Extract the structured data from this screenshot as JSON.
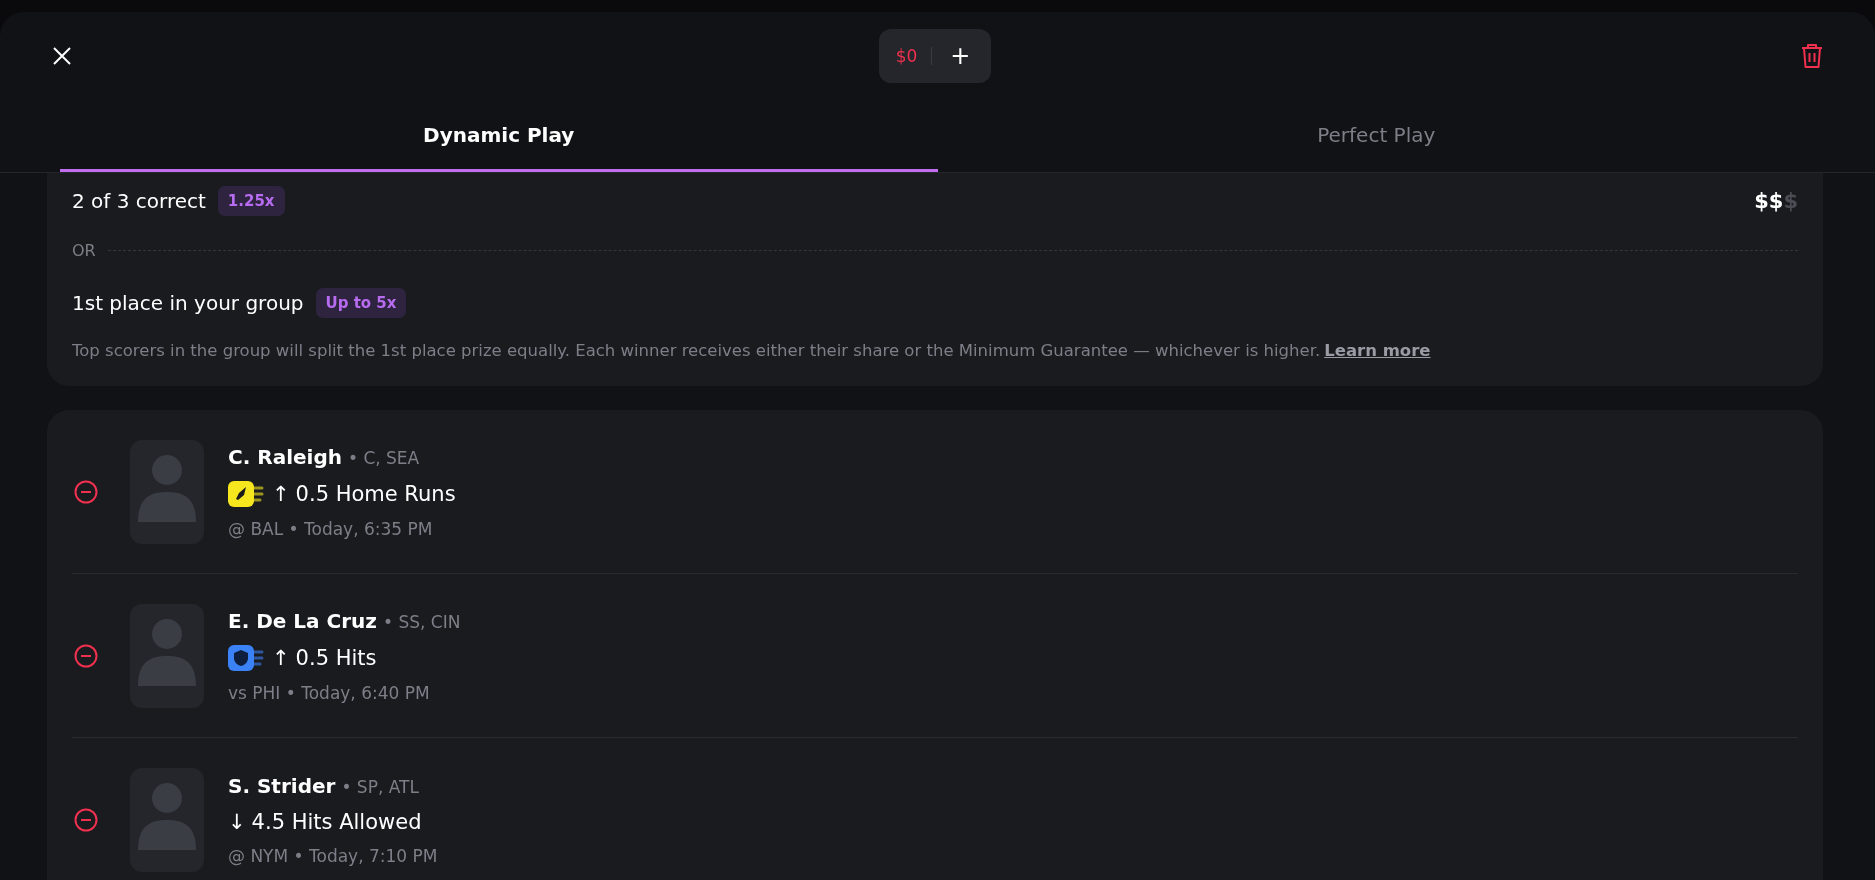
{
  "header": {
    "stake": "$0",
    "add": "+"
  },
  "tabs": [
    {
      "label": "Dynamic Play",
      "selected": true
    },
    {
      "label": "Perfect Play",
      "selected": false
    }
  ],
  "payout": {
    "correct": "2 of 3 correct",
    "multiplier": "1.25x",
    "cost": [
      {
        "symbol": "$",
        "on": true
      },
      {
        "symbol": "$",
        "on": true
      },
      {
        "symbol": "$",
        "on": false
      }
    ],
    "or": "OR",
    "group": "1st place in your group",
    "group_badge": "Up to 5x",
    "note": "Top scorers in the group will split the 1st place prize equally. Each winner receives either their share or the Minimum Guarantee — whichever is higher.",
    "link": "Learn more"
  },
  "picks": [
    {
      "name": "C. Raleigh",
      "position": "• C, SEA",
      "kind": "rocket",
      "arrow": "↑",
      "prop": "0.5 Home Runs",
      "game": "@ BAL • Today, 6:35 PM"
    },
    {
      "name": "E. De La Cruz",
      "position": "• SS, CIN",
      "kind": "shield",
      "arrow": "↑",
      "prop": "0.5 Hits",
      "game": "vs PHI • Today, 6:40 PM"
    },
    {
      "name": "S. Strider",
      "position": "• SP, ATL",
      "kind": "plain",
      "arrow": "↓",
      "prop": "4.5 Hits Allowed",
      "game": "@ NYM • Today, 7:10 PM"
    }
  ]
}
